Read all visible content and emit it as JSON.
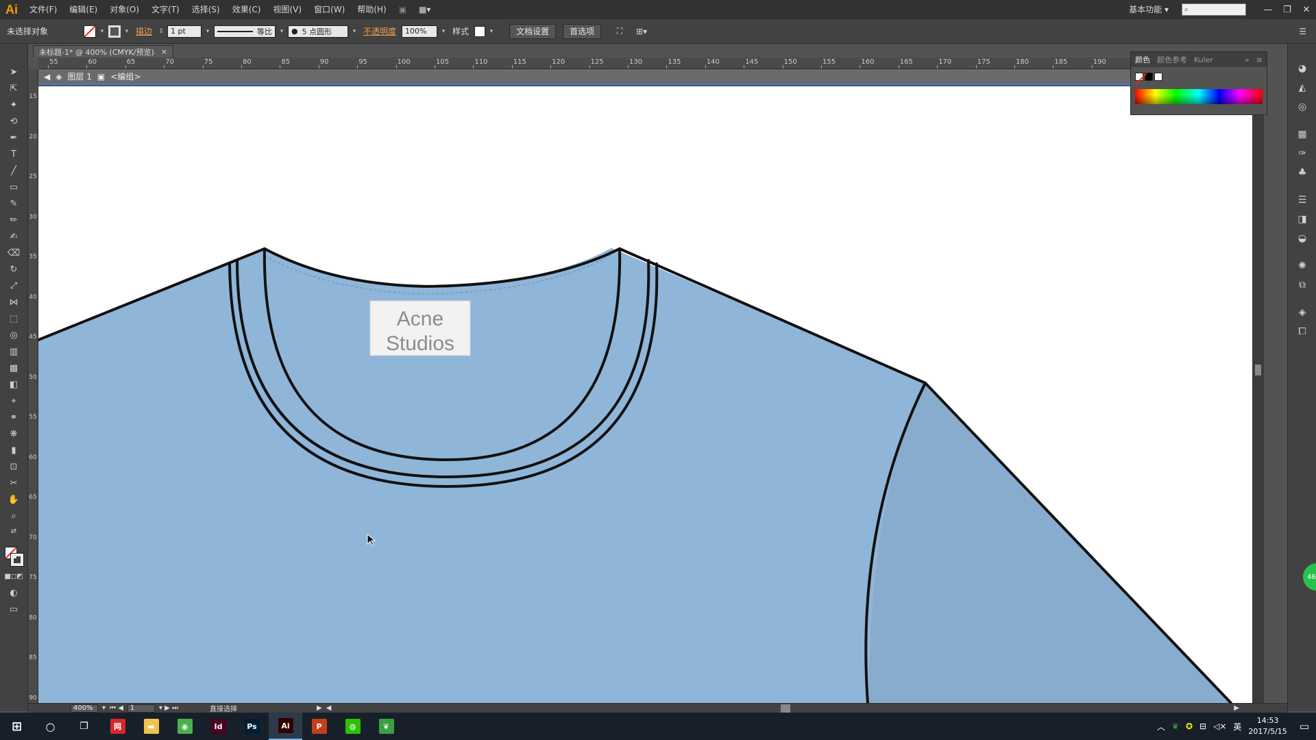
{
  "app": {
    "logo": "Ai"
  },
  "menu": [
    "文件(F)",
    "编辑(E)",
    "对象(O)",
    "文字(T)",
    "选择(S)",
    "效果(C)",
    "视图(V)",
    "窗口(W)",
    "帮助(H)"
  ],
  "workspace": {
    "label": "基本功能",
    "search_icon": "search-icon"
  },
  "control": {
    "selection": "未选择对象",
    "stroke_label": "描边",
    "stroke_weight": "1 pt",
    "profile": "等比",
    "brush": "5 点圆形",
    "opacity_label": "不透明度",
    "opacity": "100%",
    "style_label": "样式",
    "doc_setup": "文档设置",
    "preferences": "首选项"
  },
  "document": {
    "tab_title": "未标题-1* @ 400% (CMYK/预览)"
  },
  "breadcrumb": {
    "layer": "图层 1",
    "group": "<编组>"
  },
  "ruler": {
    "top": [
      "55",
      "60",
      "65",
      "70",
      "75",
      "80",
      "85",
      "90",
      "95",
      "100",
      "105",
      "110",
      "115",
      "120",
      "125",
      "130",
      "135",
      "140",
      "145",
      "150",
      "155",
      "160",
      "165",
      "170",
      "175",
      "180",
      "185",
      "190"
    ],
    "left": [
      "15",
      "20",
      "25",
      "30",
      "35",
      "40",
      "45",
      "50",
      "55",
      "60",
      "65",
      "70",
      "75",
      "80",
      "85",
      "90"
    ]
  },
  "artwork": {
    "label_line1": "Acne",
    "label_line2": "Studios",
    "fabric_color": "#8fb6d9",
    "outline_color": "#111111"
  },
  "color_panel": {
    "tabs": [
      "颜色",
      "颜色参考",
      "Kuler"
    ]
  },
  "status": {
    "zoom": "400%",
    "page": "1",
    "tool": "直接选择"
  },
  "taskbar": {
    "apps": [
      {
        "name": "netease-music",
        "label": "网",
        "color": "#d6282a"
      },
      {
        "name": "file-explorer",
        "label": "▬",
        "color": "#f2c14e"
      },
      {
        "name": "chrome",
        "label": "◉",
        "color": "#4caf50"
      },
      {
        "name": "indesign",
        "label": "Id",
        "color": "#49021f"
      },
      {
        "name": "photoshop",
        "label": "Ps",
        "color": "#001d34"
      },
      {
        "name": "illustrator",
        "label": "Ai",
        "color": "#330000"
      },
      {
        "name": "powerpoint",
        "label": "P",
        "color": "#c43e1c"
      },
      {
        "name": "wechat",
        "label": "◍",
        "color": "#2dc100"
      },
      {
        "name": "leaf-app",
        "label": "❦",
        "color": "#3aa040"
      }
    ],
    "ime": "英",
    "time": "14:53",
    "date": "2017/5/15"
  }
}
